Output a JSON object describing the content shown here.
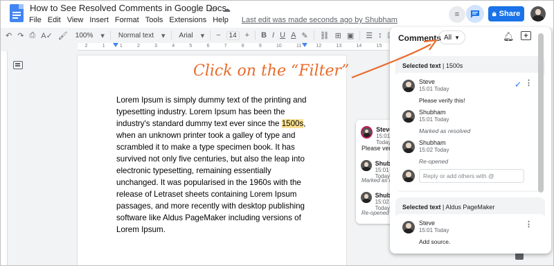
{
  "header": {
    "doc_title": "How to See Resolved Comments in Google Docs",
    "menu": [
      "File",
      "Edit",
      "View",
      "Insert",
      "Format",
      "Tools",
      "Extensions",
      "Help"
    ],
    "last_edit": "Last edit was made seconds ago by Shubham",
    "share_label": "Share",
    "accent": "#1a73e8"
  },
  "toolbar": {
    "zoom": "100%",
    "style": "Normal text",
    "font": "Arial",
    "font_size": "14"
  },
  "ruler": {
    "labels": [
      "2",
      "1",
      "1",
      "2",
      "3",
      "4",
      "5",
      "6",
      "7",
      "8",
      "9",
      "10",
      "11",
      "12",
      "13",
      "14",
      "15"
    ]
  },
  "document": {
    "text_before": "Lorem Ipsum is simply dummy text of the printing and typesetting industry. Lorem Ipsum has been the industry's standard dummy text ever since the ",
    "highlight": "1500s",
    "text_after": ", when an unknown printer took a galley of type and scrambled it to make a type specimen book. It has survived not only five centuries, but also the leap into electronic typesetting, remaining essentially unchanged. It was popularised in the 1960s with the release of Letraset sheets containing Lorem Ipsum passages, and more recently with desktop publishing software like Aldus PageMaker including versions of Lorem Ipsum.",
    "highlight_color": "#fde293"
  },
  "annotation": {
    "text": "Click on the “Filter”",
    "color": "#e86b2a"
  },
  "margin_card": {
    "name1": "Steve",
    "time1": "15:01 Today",
    "text1": "Please verify this!",
    "name2": "Shubham",
    "time2": "15:01 Today",
    "meta2": "Marked as resolved",
    "name3": "Shubham",
    "time3": "15:02 Today",
    "meta3": "Re-opened"
  },
  "comments_panel": {
    "title": "Comments",
    "filter_value": "All",
    "reply_placeholder": "Reply or add others with @",
    "threads": [
      {
        "selected_label": "Selected text",
        "selected_value": "1500s",
        "comments": [
          {
            "name": "Steve",
            "time": "15:01 Today",
            "text": "Please verify this!"
          },
          {
            "name": "Shubham",
            "time": "15:01 Today",
            "text": "Marked as resolved"
          },
          {
            "name": "Shubham",
            "time": "15:02 Today",
            "text": "Re-opened"
          }
        ]
      },
      {
        "selected_label": "Selected text",
        "selected_value": "Aldus PageMaker",
        "comments": [
          {
            "name": "Steve",
            "time": "15:01 Today",
            "text": "Add source."
          }
        ]
      }
    ]
  }
}
